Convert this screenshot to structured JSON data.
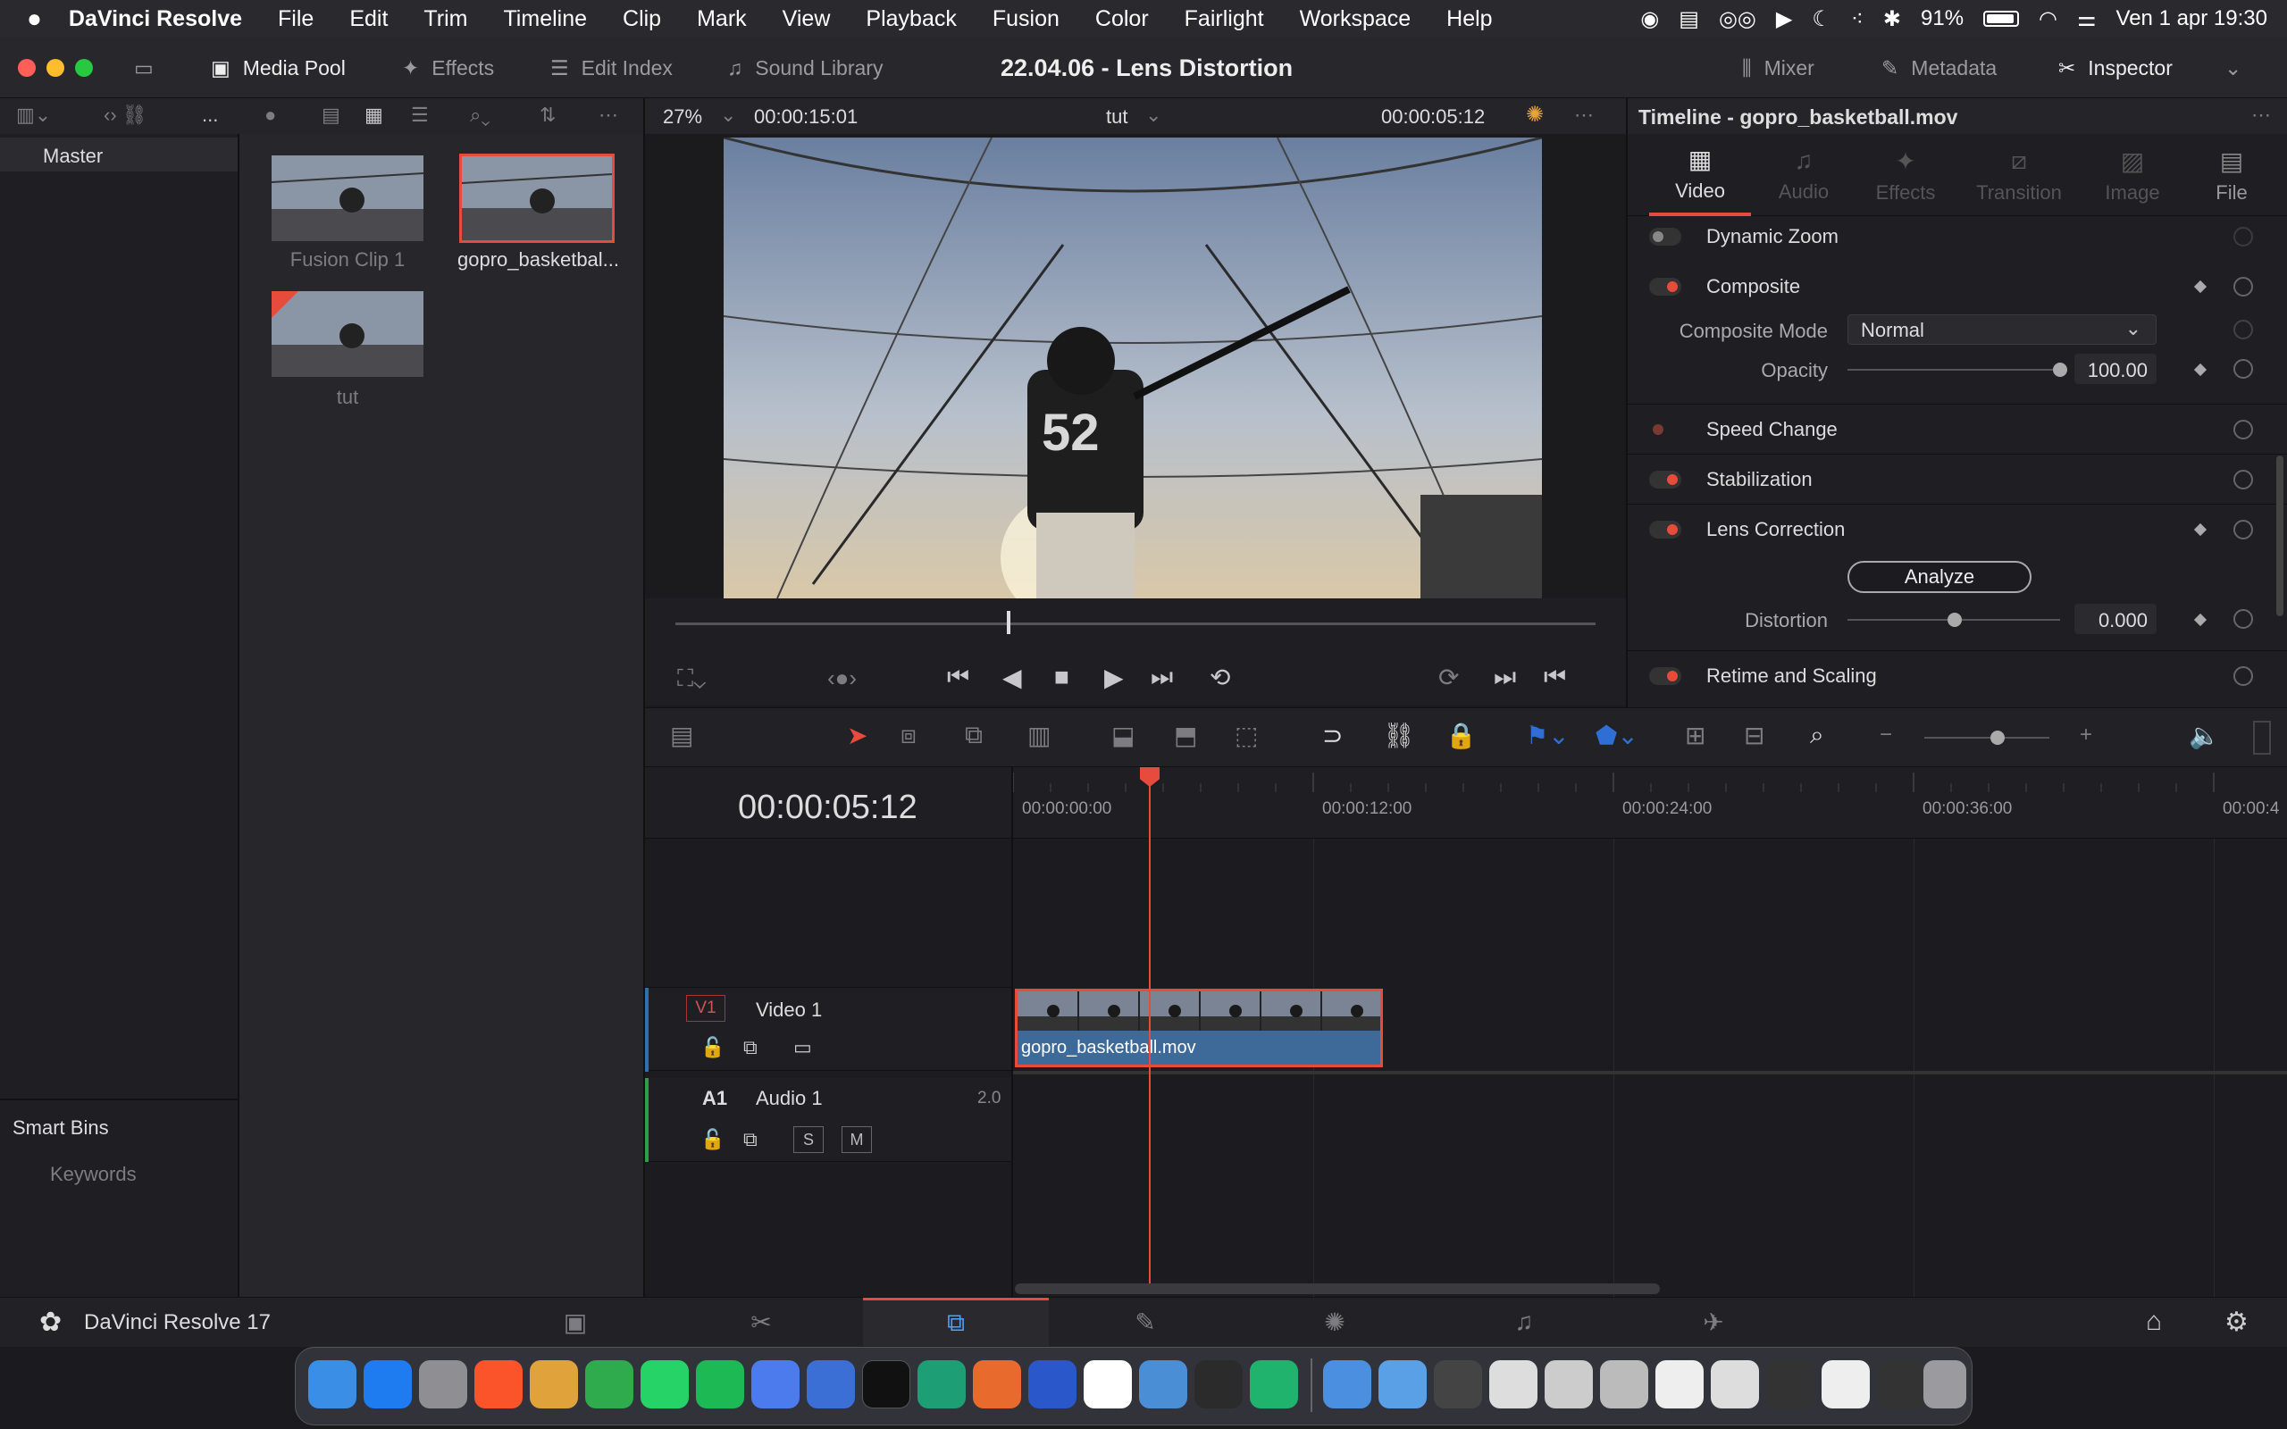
{
  "menubar": {
    "app": "DaVinci Resolve",
    "items": [
      "File",
      "Edit",
      "Trim",
      "Timeline",
      "Clip",
      "Mark",
      "View",
      "Playback",
      "Fusion",
      "Color",
      "Fairlight",
      "Workspace",
      "Help"
    ],
    "battery": "91%",
    "datetime": "Ven 1 apr  19:30"
  },
  "toolbar": {
    "media_pool": "Media Pool",
    "effects": "Effects",
    "edit_index": "Edit Index",
    "sound_library": "Sound Library",
    "project_title": "22.04.06 - Lens Distortion",
    "mixer": "Mixer",
    "metadata": "Metadata",
    "inspector": "Inspector"
  },
  "media": {
    "more": "...",
    "bin": "Master",
    "smart_bins": "Smart Bins",
    "keywords": "Keywords",
    "clips": [
      {
        "name": "Fusion Clip 1"
      },
      {
        "name": "gopro_basketbal..."
      },
      {
        "name": "tut"
      }
    ]
  },
  "viewer": {
    "zoom": "27%",
    "duration": "00:00:15:01",
    "timeline_name": "tut",
    "timecode": "00:00:05:12",
    "scrub_fraction": 0.36,
    "jersey_number": "52"
  },
  "inspector": {
    "title": "Timeline - gopro_basketball.mov",
    "tabs": [
      "Video",
      "Audio",
      "Effects",
      "Transition",
      "Image",
      "File"
    ],
    "active_tab": "Video",
    "dynamic_zoom": "Dynamic Zoom",
    "composite": "Composite",
    "composite_mode_label": "Composite Mode",
    "composite_mode_value": "Normal",
    "opacity_label": "Opacity",
    "opacity_value": "100.00",
    "speed_change": "Speed Change",
    "stabilization": "Stabilization",
    "lens_correction": "Lens Correction",
    "analyze": "Analyze",
    "distortion_label": "Distortion",
    "distortion_value": "0.000",
    "retime": "Retime and Scaling"
  },
  "timeline": {
    "timecode": "00:00:05:12",
    "ruler": [
      "00:00:00:00",
      "00:00:12:00",
      "00:00:24:00",
      "00:00:36:00",
      "00:00:4"
    ],
    "v1": {
      "badge": "V1",
      "name": "Video 1"
    },
    "a1": {
      "badge": "A1",
      "name": "Audio 1",
      "ch": "2.0",
      "solo": "S",
      "mute": "M"
    },
    "clip": "gopro_basketball.mov"
  },
  "footer": {
    "app_version": "DaVinci Resolve 17"
  },
  "colors": {
    "accent_red": "#e64b3c",
    "clip_blue": "#3e6a9a",
    "track_video": "#2f6fb5",
    "track_audio": "#2d9e48"
  }
}
